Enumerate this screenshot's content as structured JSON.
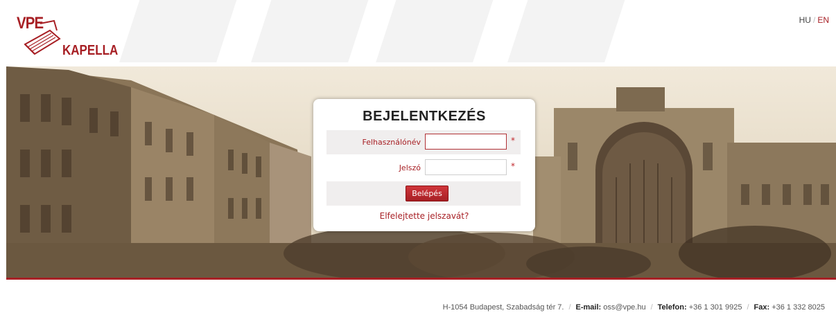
{
  "header": {
    "logo_top": "VPE",
    "logo_bottom": "KAPELLA",
    "lang": {
      "hu": "HU",
      "sep": "/",
      "en": "EN"
    }
  },
  "login": {
    "title": "BEJELENTKEZÉS",
    "username_label": "Felhasználónév",
    "username_value": "",
    "password_label": "Jelszó",
    "password_value": "",
    "required_mark": "*",
    "submit_label": "Belépés",
    "forgot_label": "Elfelejtette jelszavát?"
  },
  "footer": {
    "address": "H-1054 Budapest, Szabadság tér 7.",
    "sep": "/",
    "email_label": "E-mail:",
    "email": "oss@vpe.hu",
    "phone_label": "Telefon:",
    "phone": "+36 1 301 9925",
    "fax_label": "Fax:",
    "fax": "+36 1 332 8025"
  },
  "colors": {
    "brand": "#a71f24",
    "hero_sepia": "#cbbb9f"
  }
}
